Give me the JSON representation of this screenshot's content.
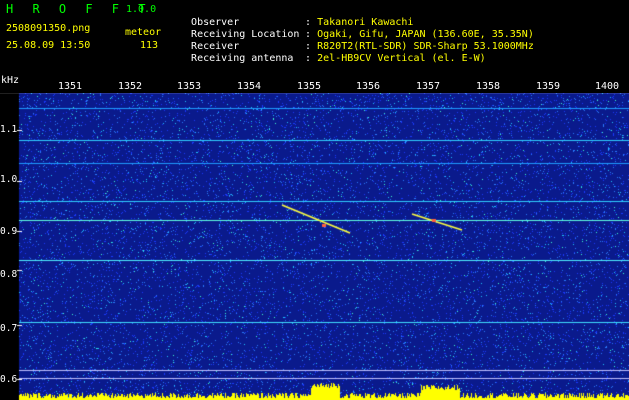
{
  "app": {
    "name": "H R O F F T",
    "version": "1.0.0"
  },
  "file": {
    "name": "2508091350.png",
    "datetime": "25.08.09 13:50"
  },
  "meteor": {
    "label": "meteor",
    "count": "113"
  },
  "info": [
    {
      "key": "Observer",
      "sep": ":",
      "value": "Takanori Kawachi"
    },
    {
      "key": "Receiving Location",
      "sep": ":",
      "value": "Ogaki, Gifu, JAPAN (136.60E, 35.35N)"
    },
    {
      "key": "Receiver",
      "sep": ":",
      "value": "R820T2(RTL-SDR) SDR-Sharp 53.1000MHz"
    },
    {
      "key": "Receiving antenna",
      "sep": ":",
      "value": "2el-HB9CV Vertical (el. E-W)"
    }
  ],
  "axis": {
    "unit": "kHz",
    "time_ticks": [
      "1351",
      "1352",
      "1353",
      "1354",
      "1355",
      "1356",
      "1357",
      "1358",
      "1359",
      "1400"
    ],
    "freq_ticks": [
      "1.1",
      "1.0",
      "0.9",
      "0.8",
      "0.7",
      "0.6"
    ]
  },
  "colors": {
    "background": "#0a1a8c",
    "header_bg": "#000000",
    "title": "#00ff00",
    "accent": "#ffff00"
  }
}
